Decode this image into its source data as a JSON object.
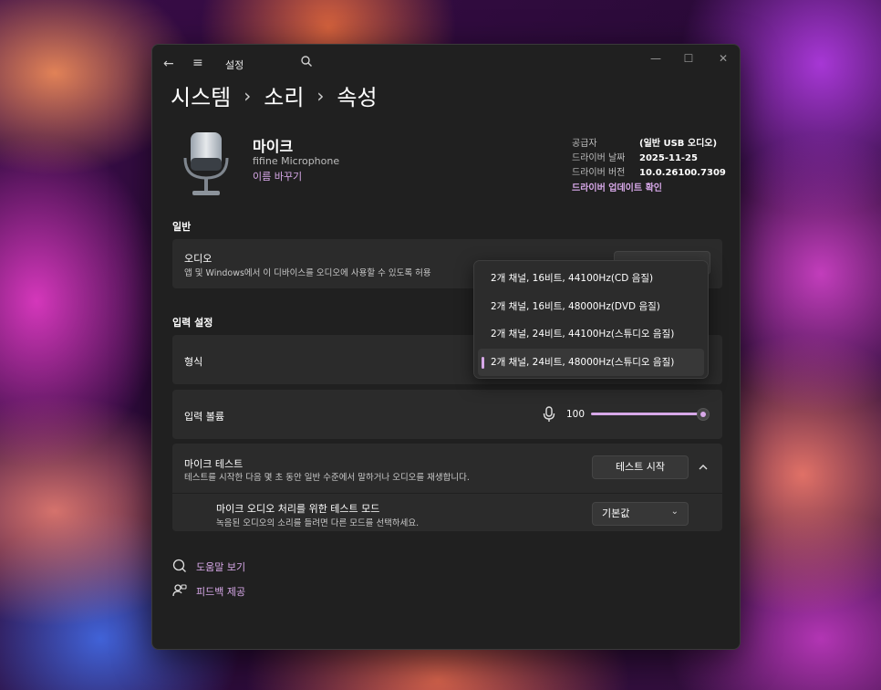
{
  "window": {
    "title": "설정",
    "controls": {
      "minimize": "—",
      "maximize": "☐",
      "close": "✕"
    }
  },
  "nav": {
    "back_icon": "←",
    "menu_icon": "≡",
    "search_icon": "search-icon"
  },
  "breadcrumb": [
    "시스템",
    "소리",
    "속성"
  ],
  "breadcrumb_separator": "›",
  "device": {
    "name": "마이크",
    "model": "fifine Microphone",
    "rename": "이름 바꾸기",
    "icon": "microphone-icon"
  },
  "driver_info": {
    "rows": [
      {
        "label": "공급자",
        "value": "(일반 USB 오디오)"
      },
      {
        "label": "드라이버 날짜",
        "value": "2025-11-25"
      },
      {
        "label": "드라이버 버전",
        "value": "10.0.26100.7309"
      }
    ],
    "update_link": "드라이버 업데이트 확인"
  },
  "general": {
    "title": "일반",
    "audio": {
      "title": "오디오",
      "description": "앱 및 Windows에서 이 디바이스를 오디오에 사용할 수 있도록 허용"
    }
  },
  "input_settings": {
    "title": "입력 설정",
    "format_label": "형식",
    "volume_label": "입력 볼륨",
    "volume_value": "100",
    "volume_level": 1.0,
    "mic_icon": "microphone-icon"
  },
  "format_dropdown": {
    "options": [
      "2개 채널, 16비트, 44100Hz(CD 음질)",
      "2개 채널, 16비트, 48000Hz(DVD 음질)",
      "2개 채널, 24비트, 44100Hz(스튜디오 음질)",
      "2개 채널, 24비트, 48000Hz(스튜디오 음질)"
    ],
    "selected_index": 3
  },
  "mic_test": {
    "title": "마이크 테스트",
    "description": "테스트를 시작한 다음 몇 초 동안 일반 수준에서 말하거나 오디오를 재생합니다.",
    "start_button": "테스트 시작",
    "collapse_icon": "chevron-up-icon",
    "mode": {
      "title": "마이크 오디오 처리를 위한 테스트 모드",
      "description": "녹음된 오디오의 소리를 들려면 다른 모드를 선택하세요.",
      "selected": "기본값",
      "chevron": "⌄"
    }
  },
  "footer": {
    "help": "도움말 보기",
    "feedback": "피드백 제공"
  },
  "colors": {
    "accent": "#d7a8e8",
    "window_bg": "#202020",
    "card_bg": "#2b2b2b"
  }
}
